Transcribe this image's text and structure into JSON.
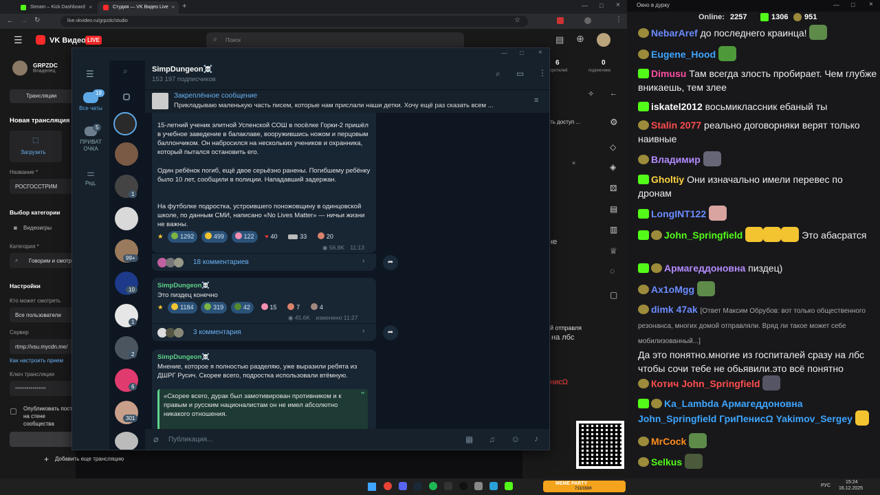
{
  "browser": {
    "tabs": [
      {
        "title": "Stream – Kick Dashboard",
        "favicon_color": "#53fc18"
      },
      {
        "title": "Студия — VK Видео Live",
        "favicon_color": "#ff2a2a"
      }
    ],
    "new_tab": "+",
    "url": "live.vkvideo.ru/grpzdc/studio"
  },
  "vk": {
    "logo": "VK Видео",
    "live_badge": "LIVE",
    "search_placeholder": "Поиск",
    "stat1_value": "6",
    "stat1_label": "зрителей",
    "stat2_value": "0",
    "stat2_label": "подписчики"
  },
  "studio": {
    "user": "GRPZDC",
    "role": "Владелец",
    "tab_broadcasts": "Трансляции",
    "new_broadcast": "Новая трансляция",
    "upload": "Загрузить",
    "name_label": "Название *",
    "name_value": "РОСГОССТРИМ",
    "category_select": "Выбор категории",
    "videogames": "Видеоигры",
    "category_label": "Категория *",
    "category_value": "Говорим и смотрим",
    "settings": "Настройки",
    "who_can_watch": "Кто может смотреть",
    "all_users": "Все пользователи",
    "server_label": "Сервер",
    "server_value": "rtmp://vsu.mycdn.me/",
    "how_to_setup": "Как настроить прием",
    "stream_key": "Ключ трансляции",
    "publish": "Опубликовать пост на стене сообщества",
    "add_broadcast": "Добавить еще трансляцию",
    "popup_text": "ть доступ ...",
    "right_fragment1": "не",
    "right_fragment2": "й отправля",
    "right_fragment3": "на лбс",
    "right_fragment4": "нисΩ"
  },
  "telegram": {
    "folders": [
      {
        "label": "Все чаты",
        "badge": "19"
      },
      {
        "label": "ПРИВАТ ОЧКА",
        "badge": "5"
      },
      {
        "label": "Ред.",
        "badge": ""
      }
    ],
    "chat_badges": [
      "",
      "",
      "1",
      "",
      "99+",
      "10",
      "1",
      "2",
      "6",
      "301",
      "1"
    ],
    "channel_name": "SimpDungeon☠️",
    "subscribers": "153 197 подписчиков",
    "pinned_title": "Закреплённое сообщение",
    "pinned_text": "Прикладываю маленькую часть писем, которые нам прислали наши детки.   Хочу ещё раз сказать всем ...",
    "post1": {
      "p1": "15-летний ученик элитной Успенской СОШ в посёлке Горки-2 пришёл в учебное заведение в балаклаве, вооружившись ножом и перцовым баллончиком. Он набросился на нескольких учеников и охранника, который пытался остановить его.",
      "p2": "Один ребёнок погиб, ещё двое серьёзно ранены. Погибшему ребёнку было 10 лет, сообщили в полиции. Нападавший задержан.",
      "p3": "На футболке подростка, устроившего поножовщину в одинцовской школе, по данным СМИ, написано «No Lives Matter» — ничьи жизни не важны.",
      "reactions": [
        "1292",
        "499",
        "122",
        "40",
        "33",
        "20"
      ],
      "views": "56.8K",
      "time": "11:13",
      "comments": "18 комментариев"
    },
    "post2": {
      "author": "SimpDungeon☠️",
      "text": "Это пиздец конечно",
      "reactions": [
        "1184",
        "319",
        "42",
        "15",
        "7",
        "4"
      ],
      "views": "45.6K",
      "edited": "изменено 11:27",
      "comments": "3 комментария"
    },
    "post3": {
      "author": "SimpDungeon☠️",
      "text": "Мнение, которое я полностью разделяю, уже выразили ребята из ДШРГ Русич. Скорее всего, подростка использовали втёмную.",
      "quote": "«Скорее всего, дурак был замотивирован противником и к правым и русским националистам он не имел абсолютно никакого отношения."
    },
    "compose_placeholder": "Публикация..."
  },
  "chat": {
    "window_title": "Окно в дурку",
    "online_label": "Online:",
    "online_count": "2257",
    "kick_count": "1306",
    "other_count": "951",
    "messages": [
      {
        "user": "NebarAref",
        "color": "#6b8cff",
        "text": "до последнего краинца!"
      },
      {
        "user": "Eugene_Hood",
        "color": "#3ea6ff",
        "text": ""
      },
      {
        "user": "Dimusu",
        "color": "#ff4fa3",
        "text": "Там всегда злость пробирает. Чем глубже вникаешь, тем злее"
      },
      {
        "user": "iskatel2012",
        "color": "#ffffff",
        "text": "восьмиклассник ебаный ты"
      },
      {
        "user": "Stalin 2077",
        "color": "#ff4d4d",
        "text": "реально договорняки верят только наивные"
      },
      {
        "user": "Владимир",
        "color": "#b48cff",
        "text": ""
      },
      {
        "user": "Gholtiy",
        "color": "#ffd23f",
        "text": "Они изначально имели перевес по дронам"
      },
      {
        "user": "LongINT122",
        "color": "#6b8cff",
        "text": ""
      },
      {
        "user": "John_Springfield",
        "color": "#53fc18",
        "text": "Это абасратся"
      },
      {
        "user": "Армагеддоновна",
        "color": "#b48cff",
        "text": "пиздец)"
      },
      {
        "user": "Ax1oMgg",
        "color": "#6b8cff",
        "text": ""
      },
      {
        "user": "dimk 47ak",
        "color": "#6b8cff",
        "reply": "[Ответ Максим Обрубов: вот только общественного резонанса, многих домой отправляли. Вряд ли такое может себе мобилизованный...]",
        "text": "Да это понятно.многие из госпиталей сразу на лбс чтобы сочи тебе не обьявили.это всё понятно"
      },
      {
        "user": "Котич",
        "color": "#ff4d4d",
        "mention": "John_Springfield",
        "text": ""
      },
      {
        "user": "Ka_Lambda",
        "color": "#3ea6ff",
        "mention": "Армагеддоновна",
        "line2": "John_Springfield ГриПенисΩ Yakimov_Sergey"
      },
      {
        "user": "MrCock",
        "color": "#ff8c1a",
        "text": ""
      },
      {
        "user": "Selkus",
        "color": "#53fc18",
        "text": ""
      }
    ]
  },
  "taskbar": {
    "lang": "РУС",
    "time": "15:24",
    "date": "16.12.2025",
    "widget": "MEME PARTY",
    "widget_value": "711/1500"
  }
}
